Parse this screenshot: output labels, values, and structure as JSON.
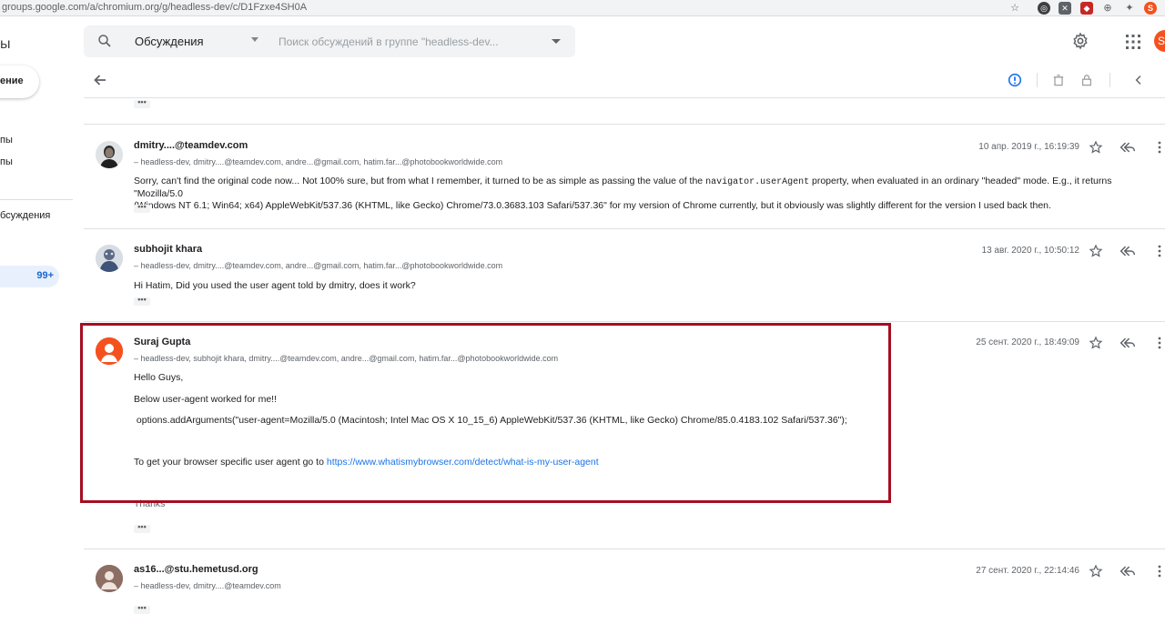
{
  "browser": {
    "url": "groups.google.com/a/chromium.org/g/headless-dev/c/D1Fzxe4SH0A",
    "profile_initial": "S"
  },
  "sidebar": {
    "title_fragment": "ы",
    "new_conversation_label": "ение",
    "items": [
      "пы",
      "пы",
      "бсуждения"
    ],
    "badge_count": "99+"
  },
  "search": {
    "scope_label": "Обсуждения",
    "placeholder": "Поиск обсуждений в группе \"headless-dev..."
  },
  "header": {
    "user_initial": "S"
  },
  "messages": [
    {
      "author": "dmitry....@teamdev.com",
      "recipients": "– headless-dev, dmitry....@teamdev.com, andre...@gmail.com, hatim.far...@photobookworldwide.com",
      "date": "10 апр. 2019 г., 16:19:39",
      "body_line1_pre": "Sorry, can't find the original code now... Not 100% sure, but from what I remember, it turned to be as simple as passing the value of the ",
      "body_code": "navigator.userAgent",
      "body_line1_post": " property, when evaluated in an ordinary \"headed\" mode. E.g., it returns \"Mozilla/5.0",
      "body_line2": "(Windows NT 6.1; Win64; x64) AppleWebKit/537.36 (KHTML, like Gecko) Chrome/73.0.3683.103 Safari/537.36\" for my version of Chrome currently, but it obviously was slightly different for the version I used back then."
    },
    {
      "author": "subhojit khara",
      "recipients": "– headless-dev, dmitry....@teamdev.com, andre...@gmail.com, hatim.far...@photobookworldwide.com",
      "date": "13 авг. 2020 г., 10:50:12",
      "body": "Hi Hatim, Did you used the user agent told by dmitry, does it work?"
    },
    {
      "author": "Suraj Gupta",
      "recipients": "– headless-dev, subhojit khara, dmitry....@teamdev.com, andre...@gmail.com, hatim.far...@photobookworldwide.com",
      "date": "25 сент. 2020 г., 18:49:09",
      "greeting": "Hello Guys,",
      "line2": "Below user-agent worked for me!!",
      "code_line": " options.addArguments(\"user-agent=Mozilla/5.0 (Macintosh; Intel Mac OS X 10_15_6) AppleWebKit/537.36 (KHTML, like Gecko) Chrome/85.0.4183.102 Safari/537.36\");",
      "line4_pre": "To get your browser specific user agent go to ",
      "link": "https://www.whatismybrowser.com/detect/what-is-my-user-agent",
      "thanks": "Thanks"
    },
    {
      "author": "as16...@stu.hemetusd.org",
      "recipients": "– headless-dev, dmitry....@teamdev.com",
      "date": "27 сент. 2020 г., 22:14:46"
    }
  ],
  "ellipsis": "•••",
  "colors": {
    "accent": "#1a73e8",
    "highlight": "#a50e22",
    "avatar_orange": "#f4511e"
  }
}
